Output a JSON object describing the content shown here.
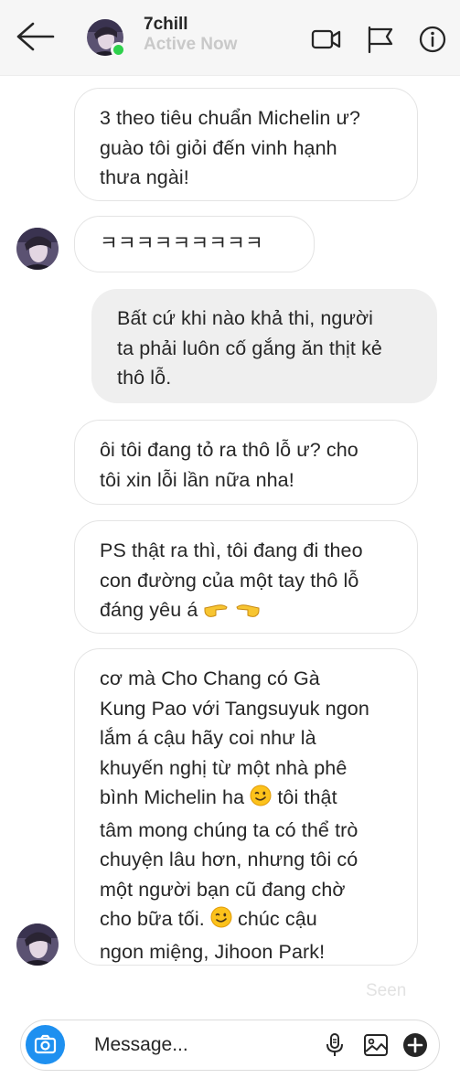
{
  "header": {
    "contact_name": "7chill",
    "status": "Active Now",
    "icons": [
      "back-arrow-icon",
      "video-call-icon",
      "flag-icon",
      "info-icon"
    ]
  },
  "messages": [
    {
      "direction": "incoming",
      "text": "3 theo tiêu chuẩn Michelin ư?\nguào tôi giỏi đến vinh hạnh\nthưa ngài!"
    },
    {
      "direction": "incoming",
      "text": "ㅋㅋㅋㅋㅋㅋㅋㅋㅋ"
    },
    {
      "direction": "outgoing",
      "text": "Bất cứ khi nào khả thi, người\nta phải luôn cố gắng ăn thịt kẻ\nthô lỗ."
    },
    {
      "direction": "incoming",
      "text": "ôi tôi đang tỏ ra thô lỗ ư? cho\ntôi xin lỗi lần nữa nha!"
    },
    {
      "direction": "incoming",
      "text_lines": [
        "PS thật ra thì, tôi đang đi theo",
        "con đường của một tay thô lỗ",
        "đáng yêu á"
      ],
      "emoji": [
        "backhand-index-pointing-right-emoji",
        "backhand-index-pointing-left-emoji"
      ]
    },
    {
      "direction": "incoming",
      "text_parts": [
        "cơ mà Cho Chang có Gà\nKung Pao với Tangsuyuk ngon\nlắm á cậu hãy coi như là\nkhuyến nghị từ một nhà phê\nbình Michelin ha",
        "tôi thật\ntâm mong chúng ta có thể trò\nchuyện lâu hơn, nhưng tôi có\nmột người bạn cũ đang chờ\ncho bữa tối.",
        "chúc cậu\nngon miệng, Jihoon Park!"
      ],
      "emoji": [
        "winking-face-emoji",
        "winking-face-emoji"
      ]
    }
  ],
  "seen_label": "Seen",
  "composer": {
    "placeholder": "Message...",
    "icons": [
      "camera-icon",
      "microphone-icon",
      "image-icon",
      "plus-icon"
    ]
  },
  "colors": {
    "online": "#2ed14c",
    "camera_button": "#1e90f0",
    "outgoing_bubble": "#efefef",
    "incoming_border": "#e4e4e4"
  }
}
